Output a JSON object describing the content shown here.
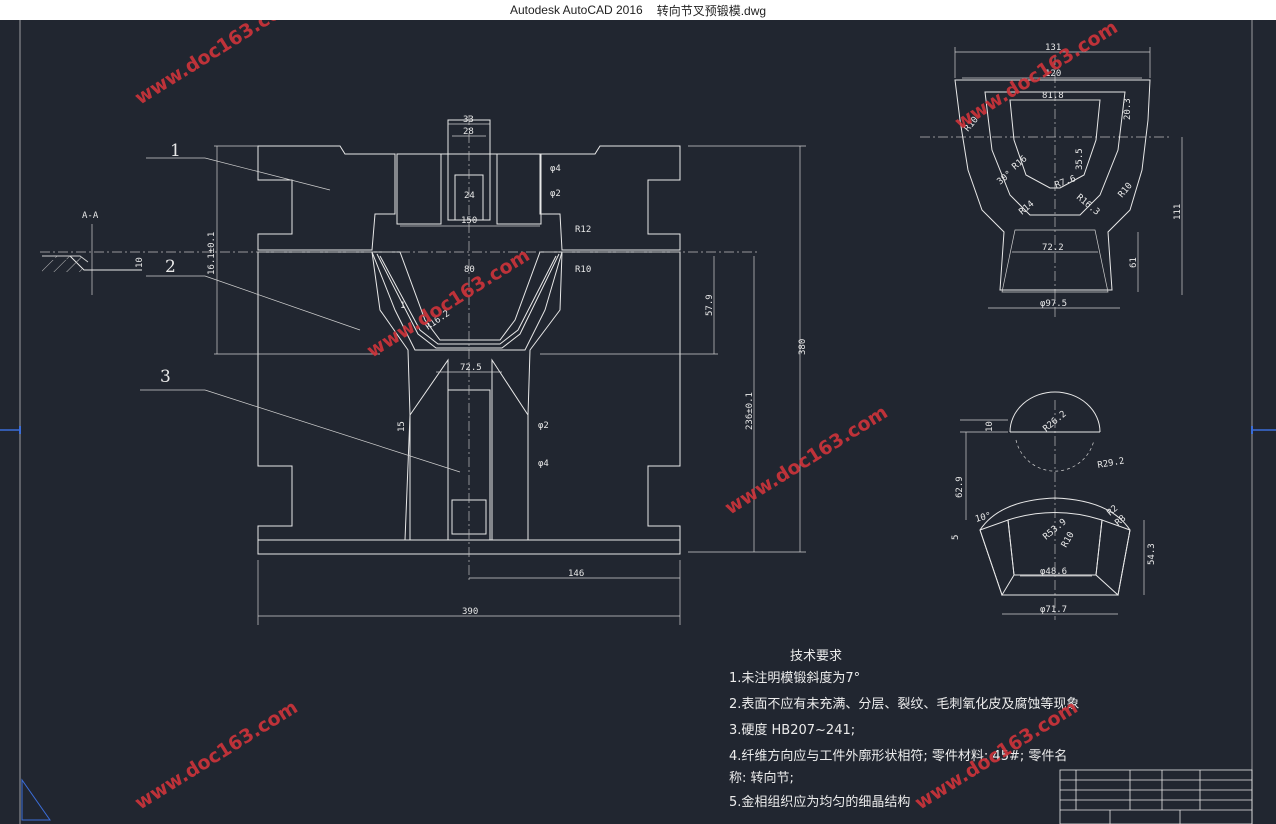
{
  "window": {
    "app_title": "Autodesk AutoCAD 2016",
    "file_name": "转向节叉预锻模.dwg"
  },
  "drawing": {
    "part_labels": [
      "1",
      "2",
      "3"
    ],
    "section_label": "A-A",
    "main_dims": {
      "d33": "33",
      "d28": "28",
      "d24": "24",
      "d150": "150",
      "d80": "80",
      "d72_5": "72.5",
      "d146": "146",
      "d390_w": "390",
      "d380_h": "380",
      "d236": "236±0.1",
      "d57_9": "57.9",
      "d16_1": "16.1±0.1",
      "d10": "10",
      "d15": "15",
      "dR12": "R12",
      "dR10": "R10",
      "dR16_2": "R16.2",
      "dphi4a": "φ4",
      "dphi2a": "φ2",
      "dphi2b": "φ2",
      "dphi4b": "φ4",
      "d1": "1"
    },
    "right_top_dims": {
      "d131": "131",
      "d120": "120",
      "d81_8": "81.8",
      "d20_3": "20.3",
      "d35_5": "35.5",
      "d111": "111",
      "d61": "61",
      "d72_2": "72.2",
      "d97_5": "φ97.5",
      "dR10a": "R10",
      "dR10b": "R10",
      "dR16": "R16",
      "dR14": "R14",
      "dR7_6": "R7.6",
      "dR16_3": "R16.3",
      "d30": "30°"
    },
    "right_bottom_dims": {
      "d10": "10",
      "d62_9": "62.9",
      "d5": "5",
      "d54_3": "54.3",
      "dR26_2": "R26.2",
      "dR29_2": "R29.2",
      "dR2": "R2",
      "dR8": "R8",
      "dR53_9": "R53.9",
      "dR10": "R10",
      "d10deg": "10°",
      "dphi48_6": "φ48.6",
      "dphi71_7": "φ71.7"
    },
    "watermark": "www.doc163.com"
  },
  "notes": {
    "title": "技术要求",
    "items": [
      "1.未注明模锻斜度为7°",
      "2.表面不应有未充满、分层、裂纹、毛刺氧化皮及腐蚀等现象",
      "3.硬度  HB207~241;",
      "4.纤维方向应与工件外廓形状相符; 零件材料: 45#; 零件名",
      "称: 转向节;",
      "5.金相组织应为均匀的细晶结构"
    ]
  }
}
